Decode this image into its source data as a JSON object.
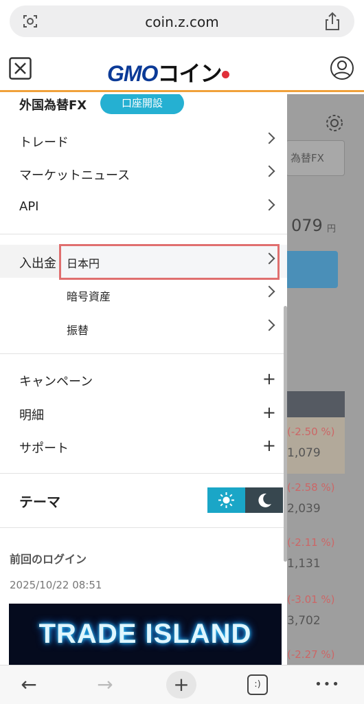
{
  "browser": {
    "url": "coin.z.com",
    "toolbar": {
      "back": "←",
      "forward": "→",
      "new_tab": "+",
      "tabs": ":)",
      "more": "•••"
    }
  },
  "header": {
    "logo_gmo": "GMO",
    "logo_coin": "コイン"
  },
  "menu": {
    "fx_label": "外国為替FX",
    "open_account": "口座開設",
    "items": [
      {
        "label": "トレード"
      },
      {
        "label": "マーケットニュース"
      },
      {
        "label": "API"
      }
    ],
    "deposit": {
      "label": "入出金",
      "sub": [
        "日本円",
        "暗号資産",
        "振替"
      ]
    },
    "expandables": [
      {
        "label": "キャンペーン"
      },
      {
        "label": "明細"
      },
      {
        "label": "サポート"
      }
    ],
    "theme_label": "テーマ",
    "last_login_label": "前回のログイン",
    "last_login_time": "2025/10/22 08:51",
    "banner_text": "TRADE ISLAND"
  },
  "background": {
    "tab_label": "為替FX",
    "price_main": "079",
    "yen": "円",
    "rows": [
      {
        "change": "(-2.50 %)",
        "value": "1,079"
      },
      {
        "change": "(-2.58 %)",
        "value": "2,039"
      },
      {
        "change": "(-2.11 %)",
        "value": "1,131"
      },
      {
        "change": "(-3.01 %)",
        "value": "3,702"
      },
      {
        "change": "(-2.27 %)",
        "value": ""
      }
    ]
  },
  "colors": {
    "accent": "#25b0d2",
    "highlight": "#e06f6f",
    "header_border": "#f0a13a",
    "logo_blue": "#0b3a97"
  }
}
